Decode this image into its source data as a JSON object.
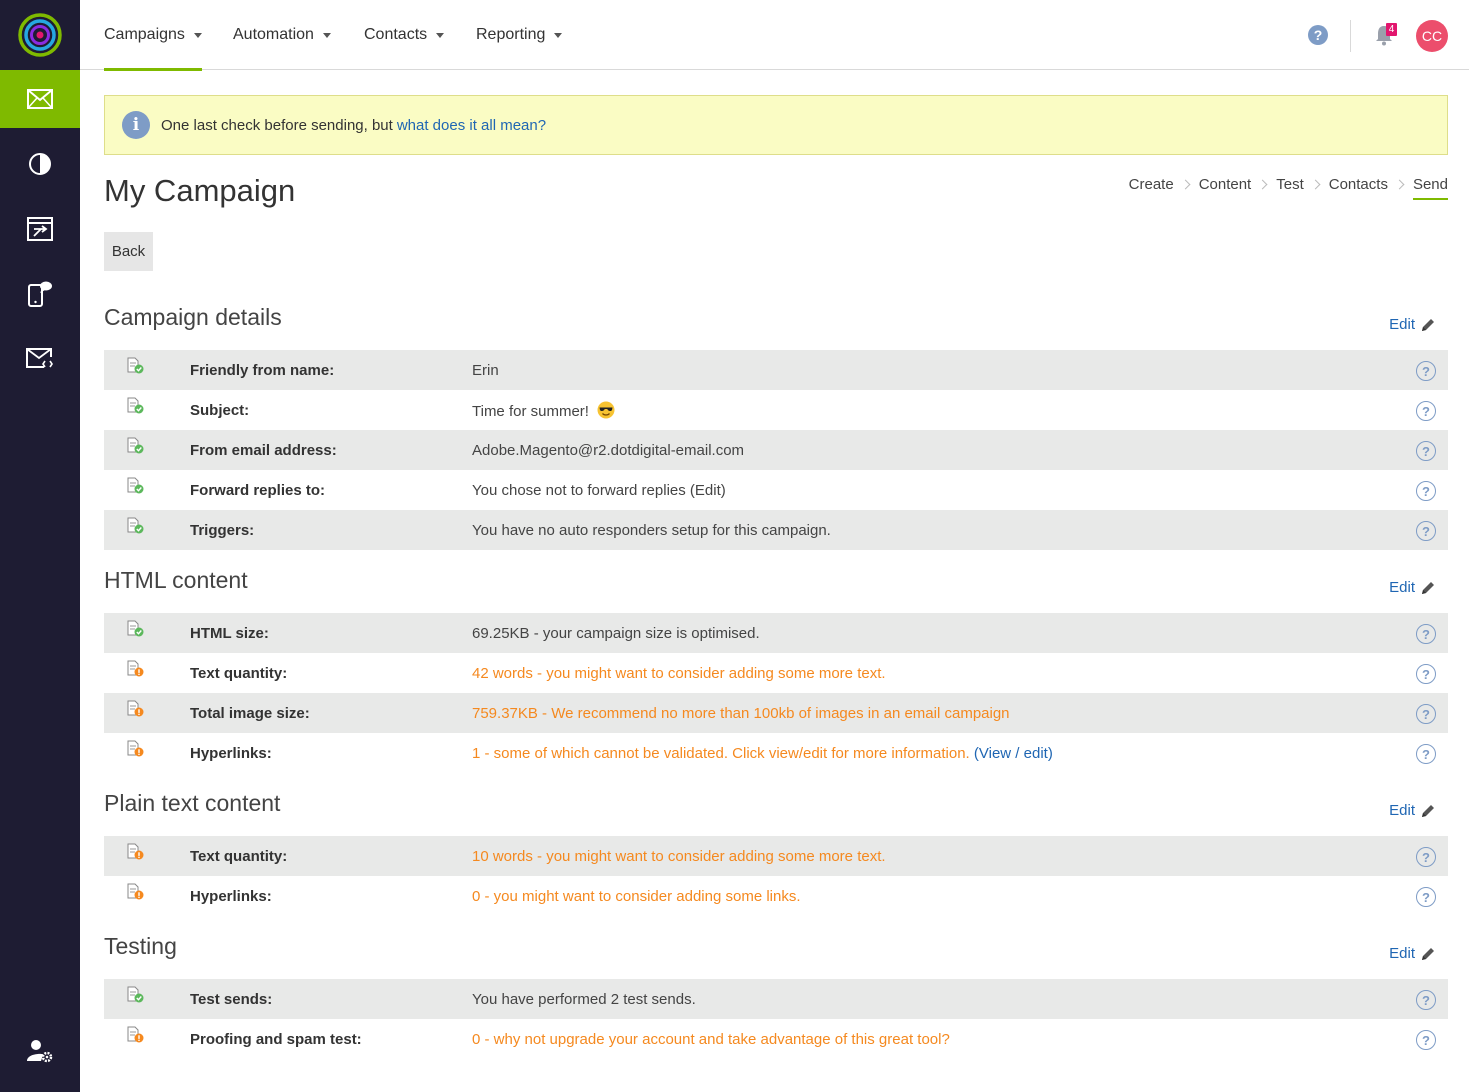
{
  "nav": {
    "items": [
      {
        "label": "Campaigns"
      },
      {
        "label": "Automation"
      },
      {
        "label": "Contacts"
      },
      {
        "label": "Reporting"
      }
    ],
    "notification_count": "4",
    "user_initials": "CC"
  },
  "alert": {
    "text": "One last check before sending, but",
    "link": "what does it all mean?"
  },
  "page": {
    "title": "My Campaign",
    "back_label": "Back"
  },
  "steps": [
    "Create",
    "Content",
    "Test",
    "Contacts",
    "Send"
  ],
  "edit_label": "Edit",
  "sections": [
    {
      "title": "Campaign details",
      "rows": [
        {
          "label": "Friendly from name:",
          "value": "Erin",
          "status": "ok"
        },
        {
          "label": "Subject:",
          "value": "Time for summer!",
          "status": "ok"
        },
        {
          "label": "From email address:",
          "value": "Adobe.Magento@r2.dotdigital-email.com",
          "status": "ok"
        },
        {
          "label": "Forward replies to:",
          "value": "You chose not to forward replies (Edit)",
          "status": "ok"
        },
        {
          "label": "Triggers:",
          "value": "You have no auto responders setup for this campaign.",
          "status": "ok"
        }
      ]
    },
    {
      "title": "HTML content",
      "rows": [
        {
          "label": "HTML size:",
          "value": "69.25KB - your campaign size is optimised.",
          "status": "ok"
        },
        {
          "label": "Text quantity:",
          "value": "42 words - you might want to consider adding some more text.",
          "status": "warn"
        },
        {
          "label": "Total image size:",
          "value": "759.37KB - We recommend no more than 100kb of images in an email campaign",
          "status": "warn"
        },
        {
          "label": "Hyperlinks:",
          "value": "1 - some of which cannot be validated. Click view/edit for more information.",
          "link": "(View / edit)",
          "status": "warn"
        }
      ]
    },
    {
      "title": "Plain text content",
      "rows": [
        {
          "label": "Text quantity:",
          "value": "10 words - you might want to consider adding some more text.",
          "status": "warn"
        },
        {
          "label": "Hyperlinks:",
          "value": "0 - you might want to consider adding some links.",
          "status": "warn"
        }
      ]
    },
    {
      "title": "Testing",
      "rows": [
        {
          "label": "Test sends:",
          "value": "You have performed 2 test sends.",
          "status": "ok"
        },
        {
          "label": "Proofing and spam test:",
          "value": "0 - why not upgrade your account and take advantage of this great tool?",
          "status": "warn"
        }
      ]
    }
  ],
  "colors": {
    "sidebar": "#1e1c33",
    "accent": "#7fba00",
    "warning": "#f5891f",
    "link": "#1f66b3",
    "alert_bg": "#fafcc4",
    "avatar": "#ec4e6c",
    "badge": "#e2166e"
  },
  "icons": {
    "sidebar": [
      "campaigns-envelope-icon",
      "reporting-pie-icon",
      "automation-program-icon",
      "mobile-sms-icon",
      "transactional-email-icon",
      "account-settings-icon"
    ],
    "row_ok": "document-check-icon",
    "row_warn": "document-warning-icon"
  }
}
